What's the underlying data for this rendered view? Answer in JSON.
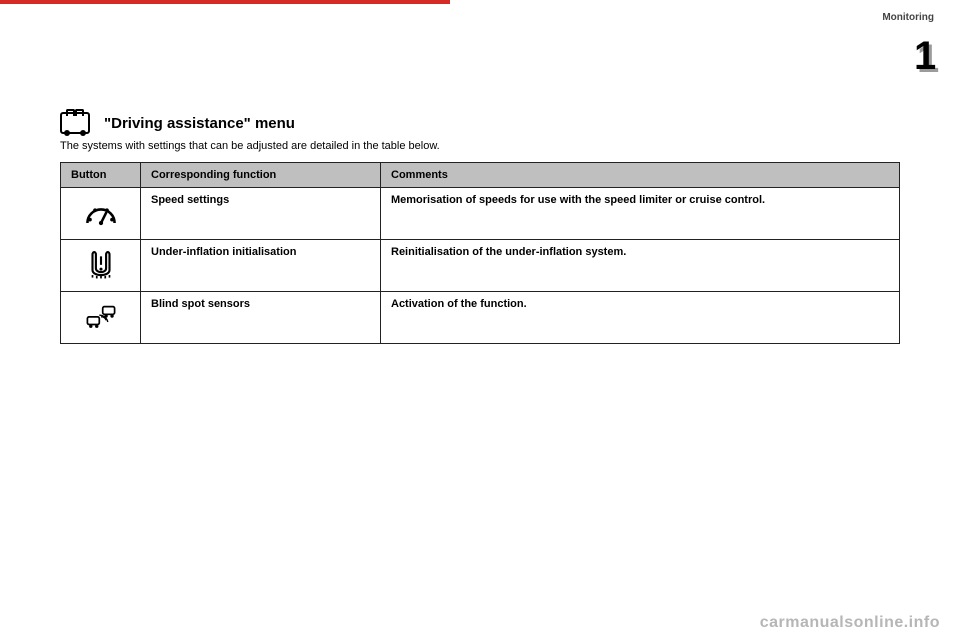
{
  "chapter_label": "Monitoring",
  "chapter_number": "1",
  "heading": "\"Driving assistance\" menu",
  "intro": "The systems with settings that can be adjusted are detailed in the table below.",
  "table": {
    "headers": {
      "button": "Button",
      "function": "Corresponding function",
      "comments": "Comments"
    },
    "rows": [
      {
        "icon": "speed-gauge-icon",
        "function": "Speed settings",
        "comment": "Memorisation of speeds for use with the speed limiter or cruise control."
      },
      {
        "icon": "tyre-pressure-icon",
        "function": "Under-inflation initialisation",
        "comment": "Reinitialisation of the under-inflation system."
      },
      {
        "icon": "blind-spot-icon",
        "function": "Blind spot sensors",
        "comment": "Activation of the function."
      }
    ]
  },
  "watermark": "carmanualsonline.info"
}
